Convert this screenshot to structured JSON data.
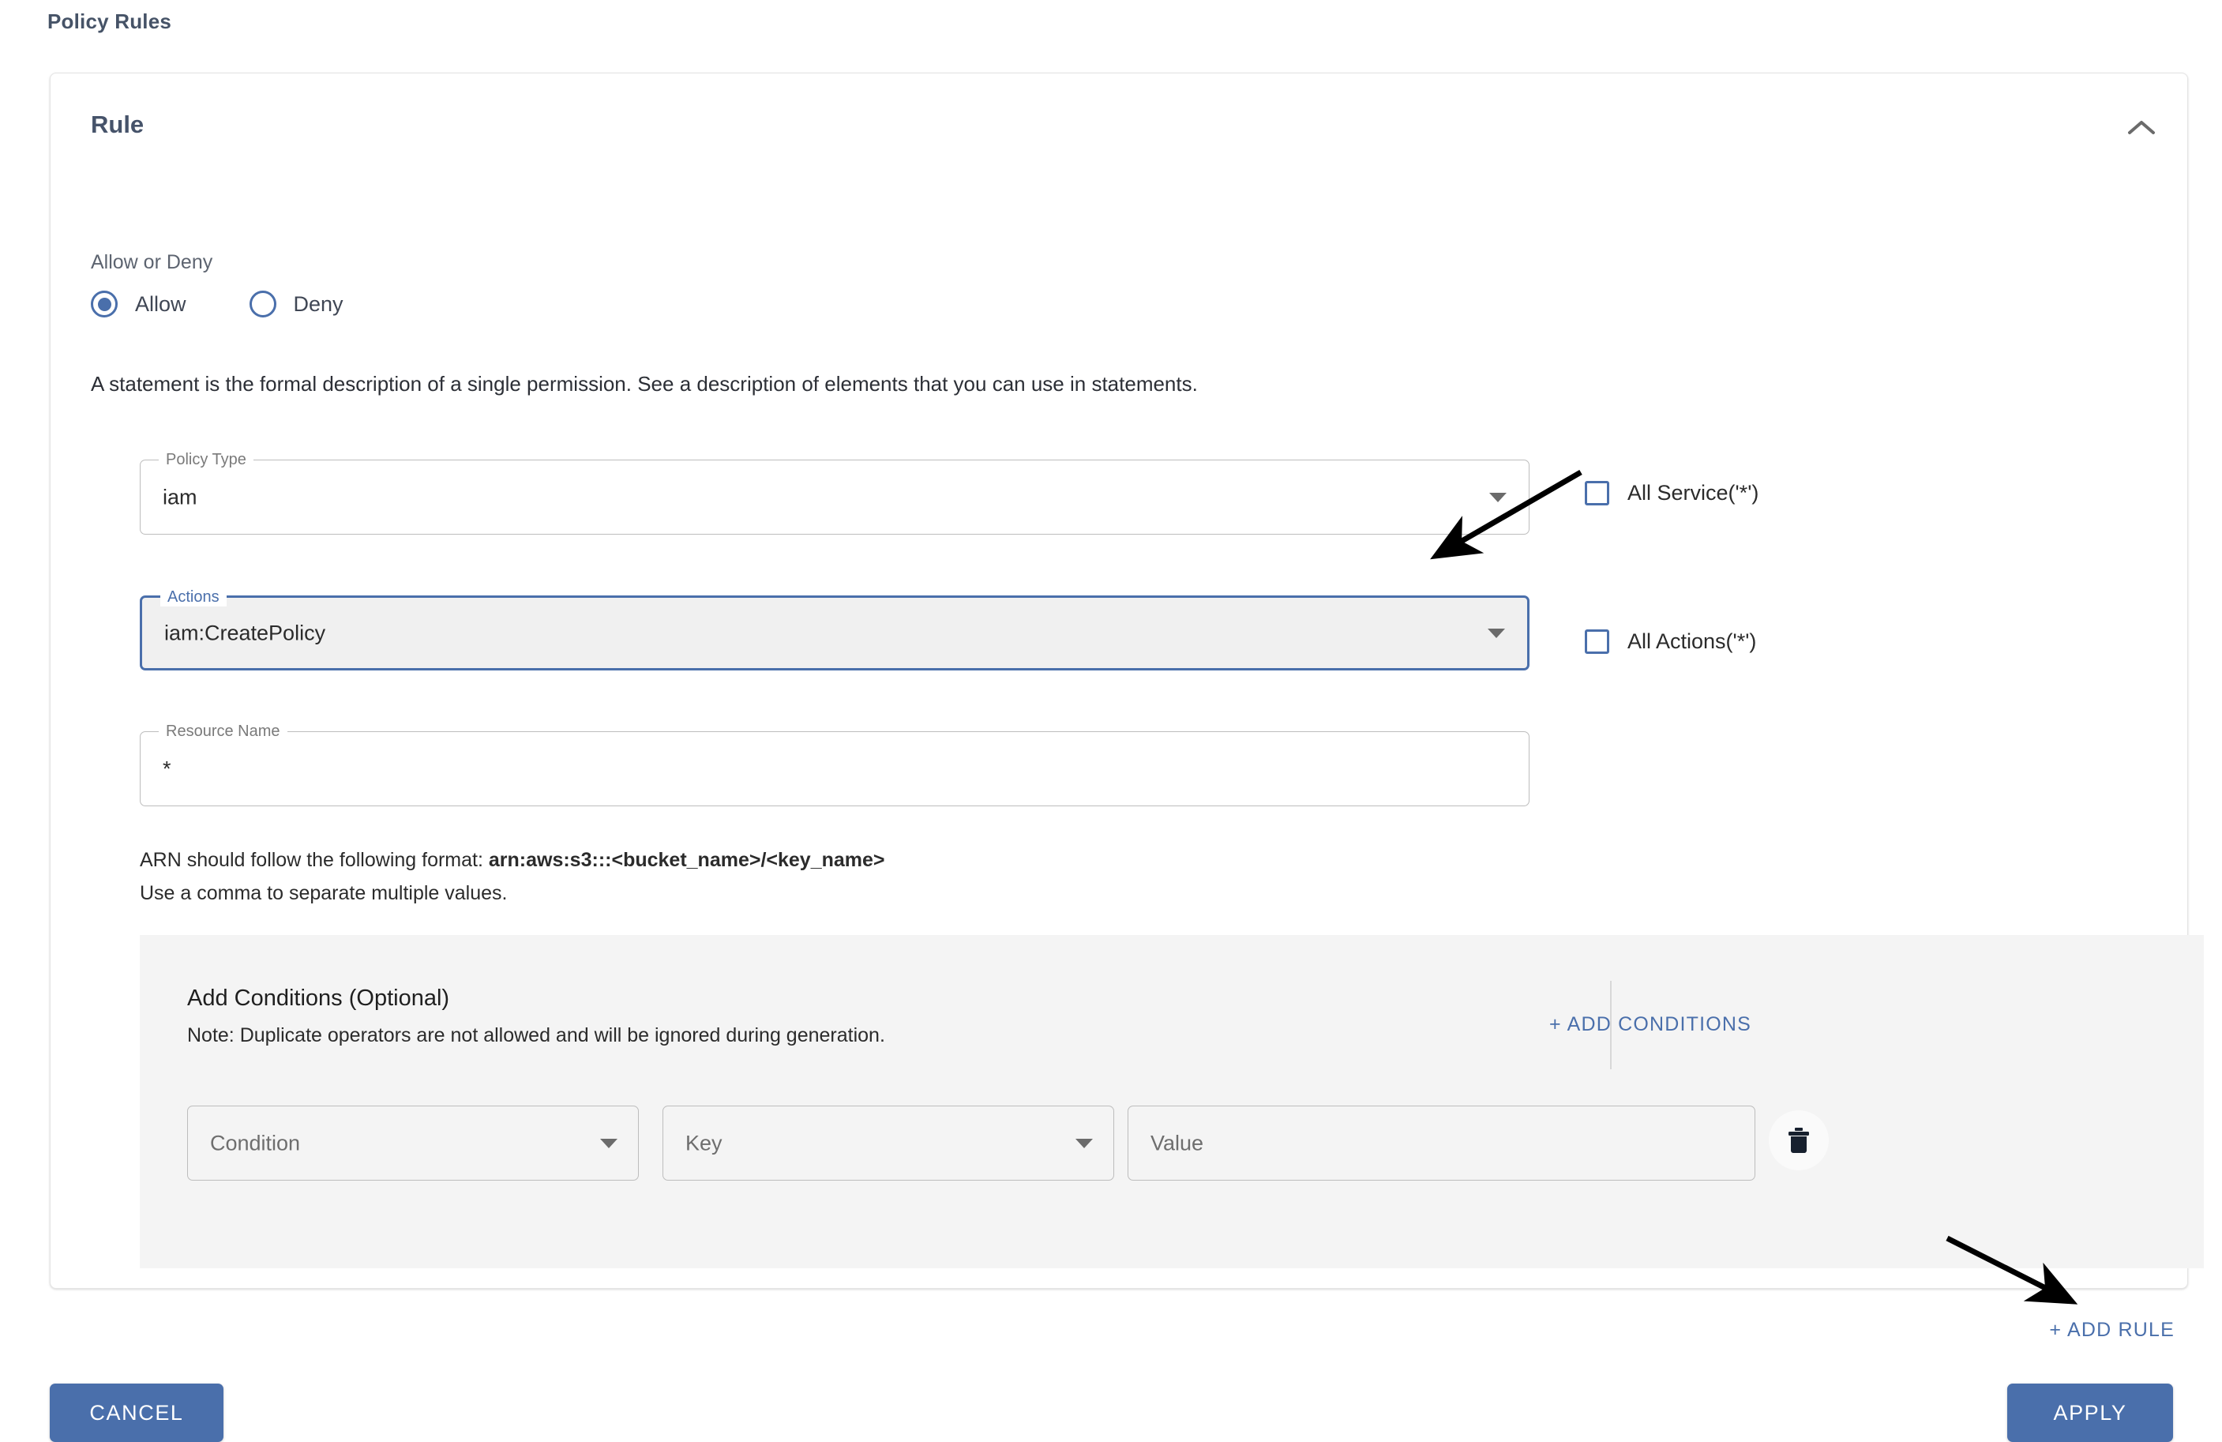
{
  "page": {
    "title": "Policy Rules"
  },
  "rule_card": {
    "heading": "Rule",
    "collapse_icon": "chevron-up-icon",
    "allow_deny_label": "Allow or Deny",
    "radio_options": [
      {
        "label": "Allow",
        "selected": true
      },
      {
        "label": "Deny",
        "selected": false
      }
    ],
    "statement_text": "A statement is the formal description of a single permission. See a description of elements that you can use in statements.",
    "fields": {
      "policy_type": {
        "legend": "Policy Type",
        "value": "iam",
        "focused": false,
        "caret_icon": "chevron-down-icon"
      },
      "actions": {
        "legend": "Actions",
        "value": "iam:CreatePolicy",
        "focused": true,
        "caret_icon": "chevron-down-icon"
      },
      "resource_name": {
        "legend": "Resource Name",
        "value": "*",
        "focused": false
      }
    },
    "checkboxes": [
      {
        "label": "All Service('*')",
        "checked": false
      },
      {
        "label": "All Actions('*')",
        "checked": false
      }
    ],
    "arn_help": {
      "prefix": "ARN should follow the following format: ",
      "format": "arn:aws:s3:::<bucket_name>/<key_name>",
      "second_line": "Use a comma to separate multiple values."
    },
    "conditions": {
      "title": "Add Conditions (Optional)",
      "note": "Note: Duplicate operators are not allowed and will be ignored during generation.",
      "add_link": "+ ADD CONDITIONS",
      "row": {
        "condition_placeholder": "Condition",
        "key_placeholder": "Key",
        "value_placeholder": "Value",
        "delete_icon": "trash-icon"
      }
    }
  },
  "add_rule_link": "+ ADD RULE",
  "footer": {
    "cancel_label": "CANCEL",
    "apply_label": "APPLY"
  },
  "colors": {
    "accent_blue": "#4a6fab",
    "heading_gray": "#465367",
    "panel_gray": "#f4f4f4",
    "field_border": "#bdbdbd",
    "annotation_black": "#000000"
  }
}
